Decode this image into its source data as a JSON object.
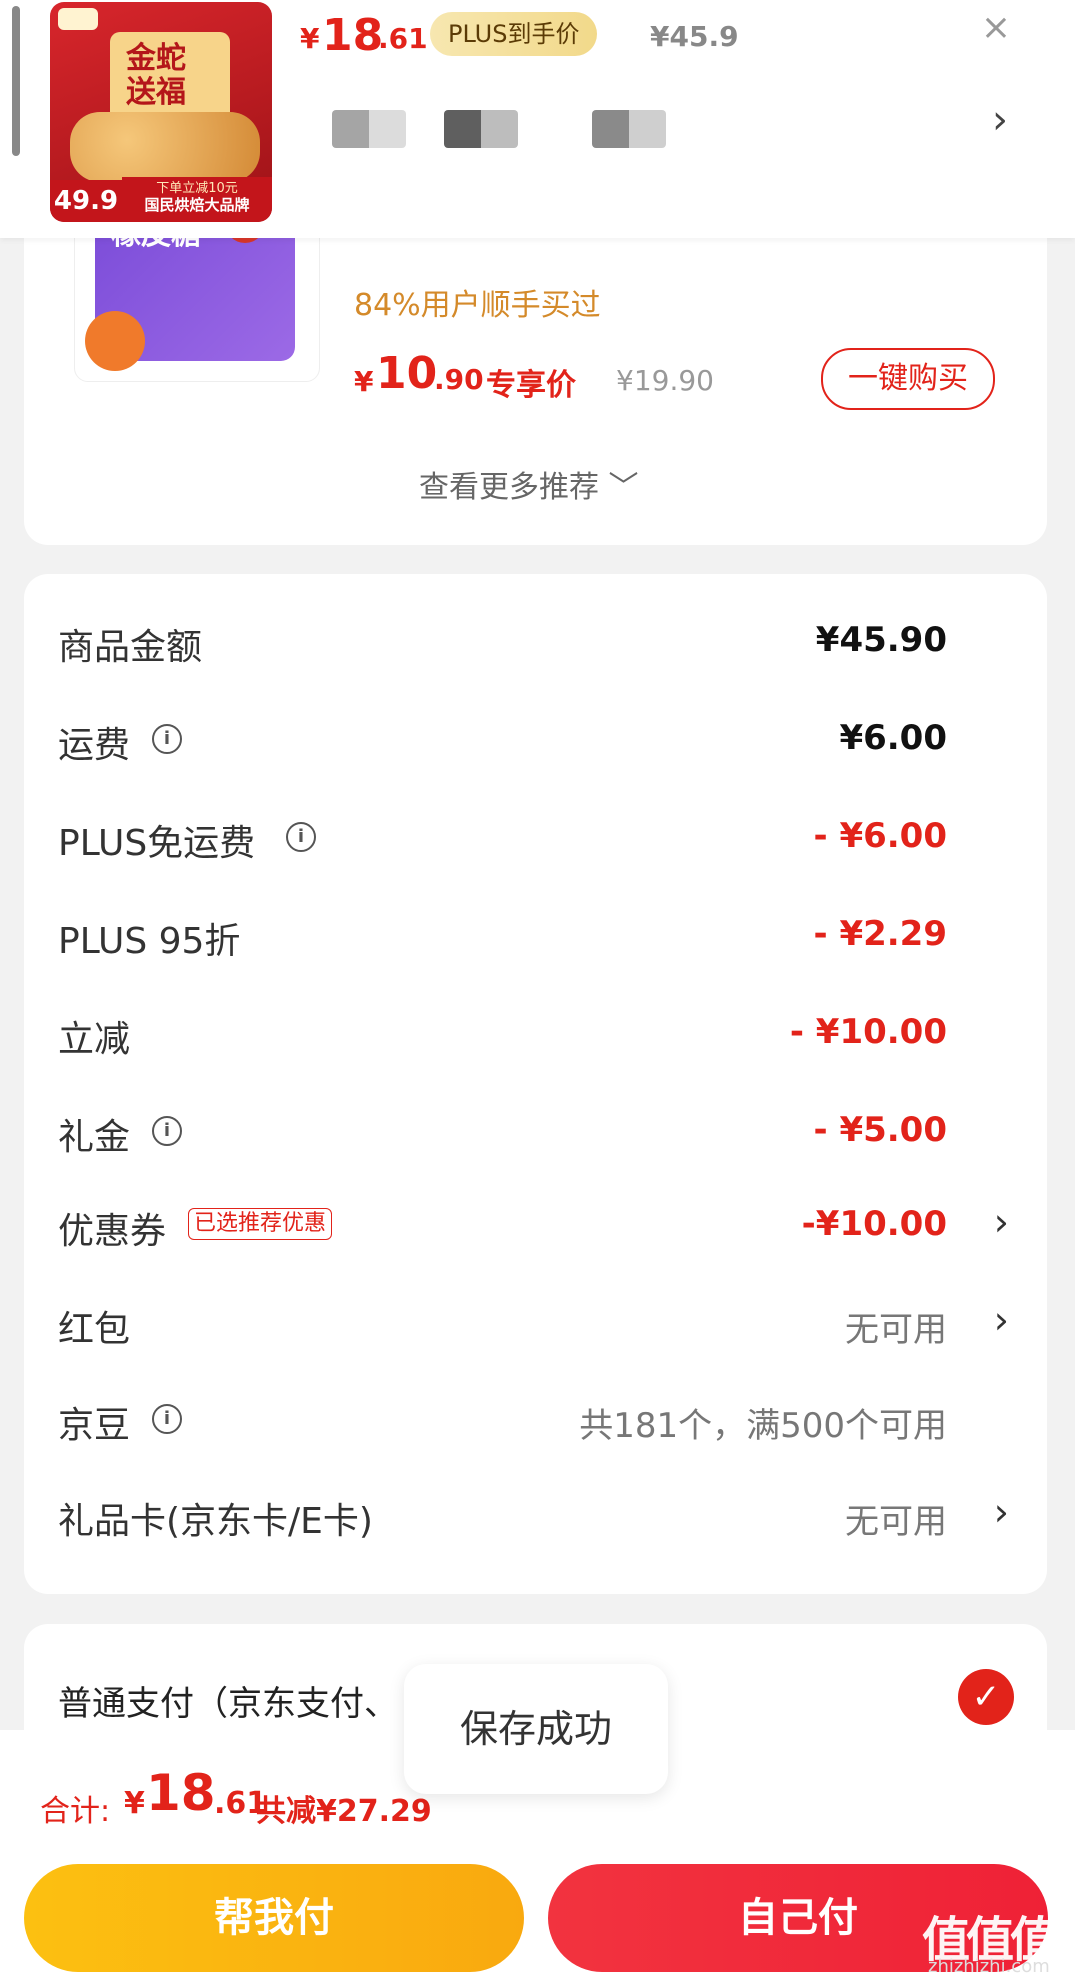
{
  "header": {
    "price_symbol": "¥",
    "price_int": "18",
    "price_dec": ".61",
    "plus_badge": "PLUS到手价",
    "orig_price": "¥45.9",
    "close_icon": "×",
    "chevron": "›",
    "thumb": {
      "panel_text": "金蛇送福",
      "badge_left": "49.9",
      "banner_line1": "下单立减10元",
      "banner_line2": "国民烘焙大品牌"
    }
  },
  "recommendation": {
    "thumb_text": "橡皮糖",
    "buyers": "84%用户顺手买过",
    "price_symbol": "¥",
    "price_int": "10",
    "price_dec": ".90",
    "exclusive_label": "专享价",
    "orig_price": "¥19.90",
    "one_click": "一键购买",
    "see_more": "查看更多推荐 ﹀"
  },
  "summary": {
    "rows": [
      {
        "label": "商品金额",
        "value": "¥45.90"
      },
      {
        "label": "运费",
        "value": "¥6.00"
      },
      {
        "label": "PLUS免运费",
        "value": "- ¥6.00"
      },
      {
        "label": "PLUS 95折",
        "value": "- ¥2.29"
      },
      {
        "label": "立减",
        "value": "- ¥10.00"
      },
      {
        "label": "礼金",
        "value": "- ¥5.00"
      },
      {
        "label": "优惠券",
        "badge": "已选推荐优惠",
        "value": "-¥10.00"
      },
      {
        "label": "红包",
        "value": "无可用"
      },
      {
        "label": "京豆",
        "value": "共181个，满500个可用"
      },
      {
        "label": "礼品卡(京东卡/E卡)",
        "value": "无可用"
      }
    ],
    "info_icon": "i",
    "chevron": "›"
  },
  "payment": {
    "label": "普通支付（京东支付、",
    "check_icon": "✓"
  },
  "toast": "保存成功",
  "bottom": {
    "total_label": "合计:",
    "total_symbol": "¥",
    "total_int": "18",
    "total_dec": ".61",
    "total_saved": "共减¥27.29",
    "help_pay": "帮我付",
    "self_pay": "自己付"
  },
  "watermark": {
    "main": "值值值",
    "sub": "zhizhizhi.com"
  },
  "colors": {
    "accent_red": "#e2231a",
    "gold_button": "#fcc011",
    "red_button": "#ef2136",
    "plus_badge_bg": "#f2d98a"
  },
  "icons": [
    "close-icon",
    "chevron-right-icon",
    "info-icon",
    "check-icon",
    "chevron-down-icon"
  ]
}
